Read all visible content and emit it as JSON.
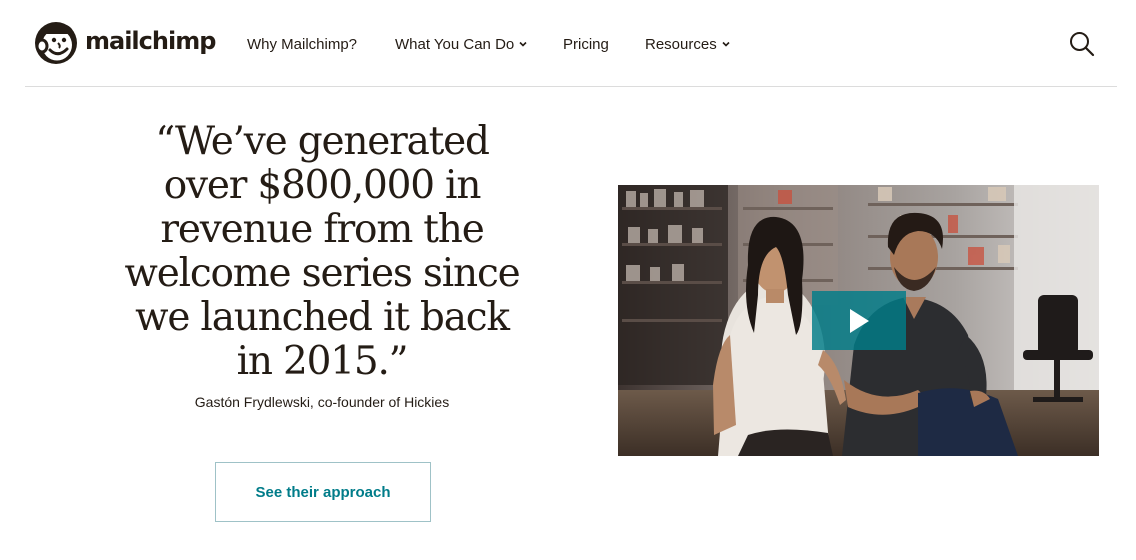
{
  "header": {
    "logo_text": "mailchimp",
    "nav": [
      {
        "label": "Why Mailchimp?",
        "has_dropdown": false
      },
      {
        "label": "What You Can Do",
        "has_dropdown": true
      },
      {
        "label": "Pricing",
        "has_dropdown": false
      },
      {
        "label": "Resources",
        "has_dropdown": true
      }
    ],
    "search_icon": "search-icon"
  },
  "testimonial": {
    "quote_lines": [
      "“We’ve generated",
      "over $800,000 in",
      "revenue from the",
      "welcome series since",
      "we launched it back",
      "in 2015.”"
    ],
    "attribution": "Gastón Frydlewski, co-founder of Hickies",
    "cta_label": "See their approach"
  },
  "video": {
    "play_icon": "play-icon"
  },
  "colors": {
    "text": "#241c15",
    "accent": "#007c89",
    "cta_border": "#9fc2c7",
    "divider": "#dcdcdc"
  }
}
